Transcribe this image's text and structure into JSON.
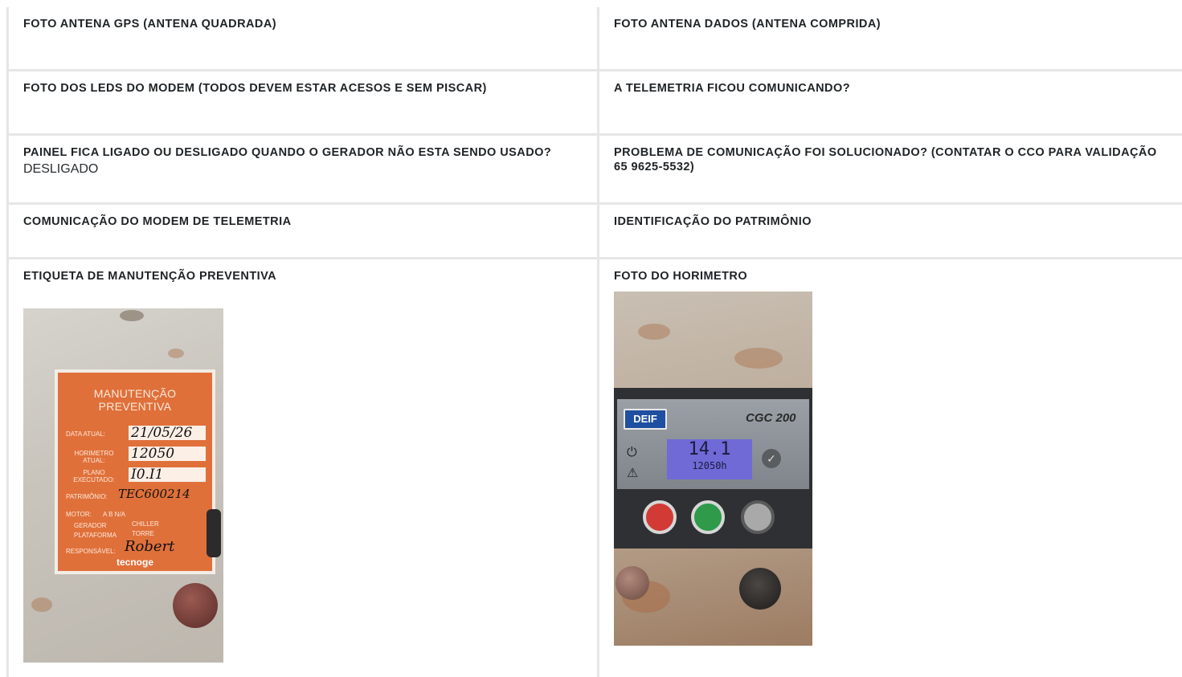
{
  "rows": [
    {
      "left": {
        "label": "FOTO ANTENA GPS (ANTENA QUADRADA)",
        "value": ""
      },
      "right": {
        "label": "FOTO ANTENA DADOS (ANTENA COMPRIDA)",
        "value": ""
      }
    },
    {
      "left": {
        "label": "FOTO DOS LEDS DO MODEM (TODOS DEVEM ESTAR ACESOS E SEM PISCAR)",
        "value": ""
      },
      "right": {
        "label": "A TELEMETRIA FICOU COMUNICANDO?",
        "value": ""
      }
    },
    {
      "left": {
        "label": "PAINEL FICA LIGADO OU DESLIGADO QUANDO O GERADOR NÃO ESTA SENDO USADO?",
        "value": "DESLIGADO"
      },
      "right": {
        "label": "PROBLEMA DE COMUNICAÇÃO FOI SOLUCIONADO? (CONTATAR O CCO PARA VALIDAÇÃO 65 9625-5532)",
        "value": ""
      }
    },
    {
      "left": {
        "label": "COMUNICAÇÃO DO MODEM DE TELEMETRIA",
        "value": ""
      },
      "right": {
        "label": "IDENTIFICAÇÃO DO PATRIMÔNIO",
        "value": ""
      }
    },
    {
      "left": {
        "label": "ETIQUETA DE MANUTENÇÃO PREVENTIVA"
      },
      "right": {
        "label": "FOTO DO HORIMETRO"
      }
    }
  ],
  "tag_photo": {
    "title_line1": "MANUTENÇÃO",
    "title_line2": "PREVENTIVA",
    "data_label": "DATA ATUAL:",
    "data_value": "21/05/26",
    "horimetro_label": "HORIMETRO ATUAL:",
    "horimetro_value": "12050",
    "plano_label": "PLANO EXECUTADO:",
    "plano_value": "I0.I1",
    "patrimonio_label": "PATRIMÔNIO:",
    "patrimonio_value": "TEC600214",
    "motor_label": "MOTOR:",
    "motor_options": "A   B   N/A",
    "gerador_label": "GERADOR",
    "chiller_label": "CHILLER",
    "plataforma_label": "PLATAFORMA",
    "torre_label": "TORRE",
    "responsavel_label": "RESPONSÁVEL:",
    "responsavel_value": "Robert",
    "brand": "tecnoge",
    "colors": {
      "card": "#e0703a",
      "plate": "#cfcac2"
    }
  },
  "hour_photo": {
    "brand": "DEIF",
    "model": "CGC 200",
    "lcd_main": "14.1",
    "lcd_hours": "12050h",
    "colors": {
      "lcd": "#6f6ad6",
      "stop": "#d23b35",
      "start": "#2e9a4a"
    }
  }
}
